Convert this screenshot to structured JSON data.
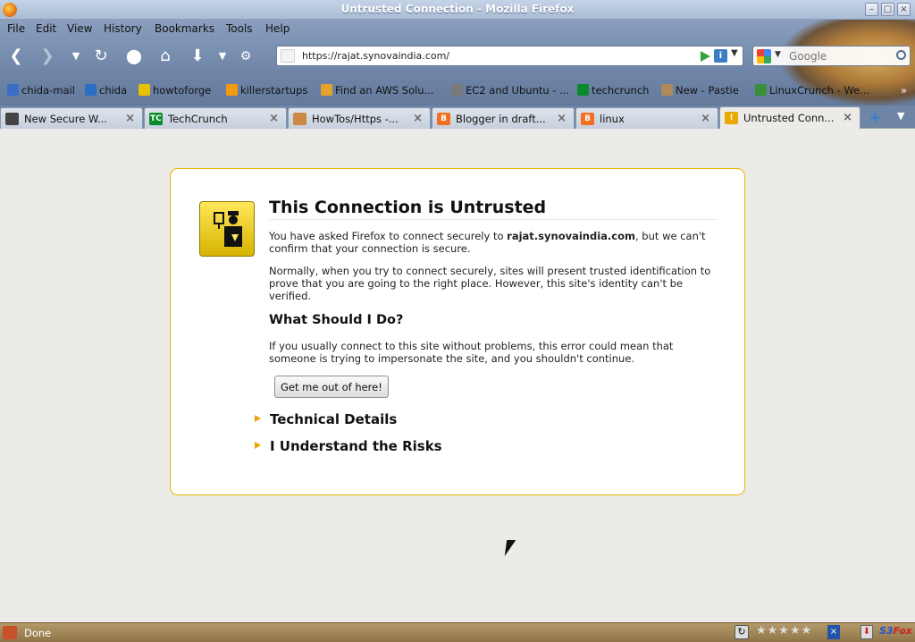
{
  "window": {
    "title": "Untrusted Connection - Mozilla Firefox"
  },
  "menu": {
    "file": "File",
    "edit": "Edit",
    "view": "View",
    "history": "History",
    "bookmarks": "Bookmarks",
    "tools": "Tools",
    "help": "Help"
  },
  "url": {
    "value": "https://rajat.synovaindia.com/"
  },
  "search": {
    "placeholder": "Google"
  },
  "bookmarks": [
    {
      "label": "chida-mail",
      "color": "#3b6fc7"
    },
    {
      "label": "chida",
      "color": "#2b6cc4"
    },
    {
      "label": "howtoforge",
      "color": "#e8c100"
    },
    {
      "label": "killerstartups",
      "color": "#f29b11"
    },
    {
      "label": "Find an AWS Solu...",
      "color": "#e6a12b"
    },
    {
      "label": "EC2 and Ubuntu - ...",
      "color": "#7a7a7a"
    },
    {
      "label": "techcrunch",
      "color": "#0a8a2a"
    },
    {
      "label": "New - Pastie",
      "color": "#b0895a"
    },
    {
      "label": "LinuxCrunch - We...",
      "color": "#3a8d3a"
    }
  ],
  "tabs": [
    {
      "label": "New Secure W...",
      "fav": "#444"
    },
    {
      "label": "TechCrunch",
      "fav": "#0a8a2a"
    },
    {
      "label": "HowTos/Https -...",
      "fav": "#c84"
    },
    {
      "label": "Blogger in draft...",
      "fav": "#f07020"
    },
    {
      "label": "linux",
      "fav": "#f07020"
    },
    {
      "label": "Untrusted Conn...",
      "fav": "#e8a800"
    }
  ],
  "error": {
    "title": "This Connection is Untrusted",
    "intro_pre": "You have asked Firefox to connect securely to ",
    "host": "rajat.synovaindia.com",
    "intro_post": ", but we can't confirm that your connection is secure.",
    "normally": "Normally, when you try to connect securely, sites will present trusted identification to prove that you are going to the right place. However, this site's identity can't be verified.",
    "what_heading": "What Should I Do?",
    "what_text": "If you usually connect to this site without problems, this error could mean that someone is trying to impersonate the site, and you shouldn't continue.",
    "button": "Get me out of here!",
    "technical": "Technical Details",
    "risks": "I Understand the Risks"
  },
  "status": {
    "text": "Done",
    "s3": "S3",
    "s3b": "Fox"
  }
}
